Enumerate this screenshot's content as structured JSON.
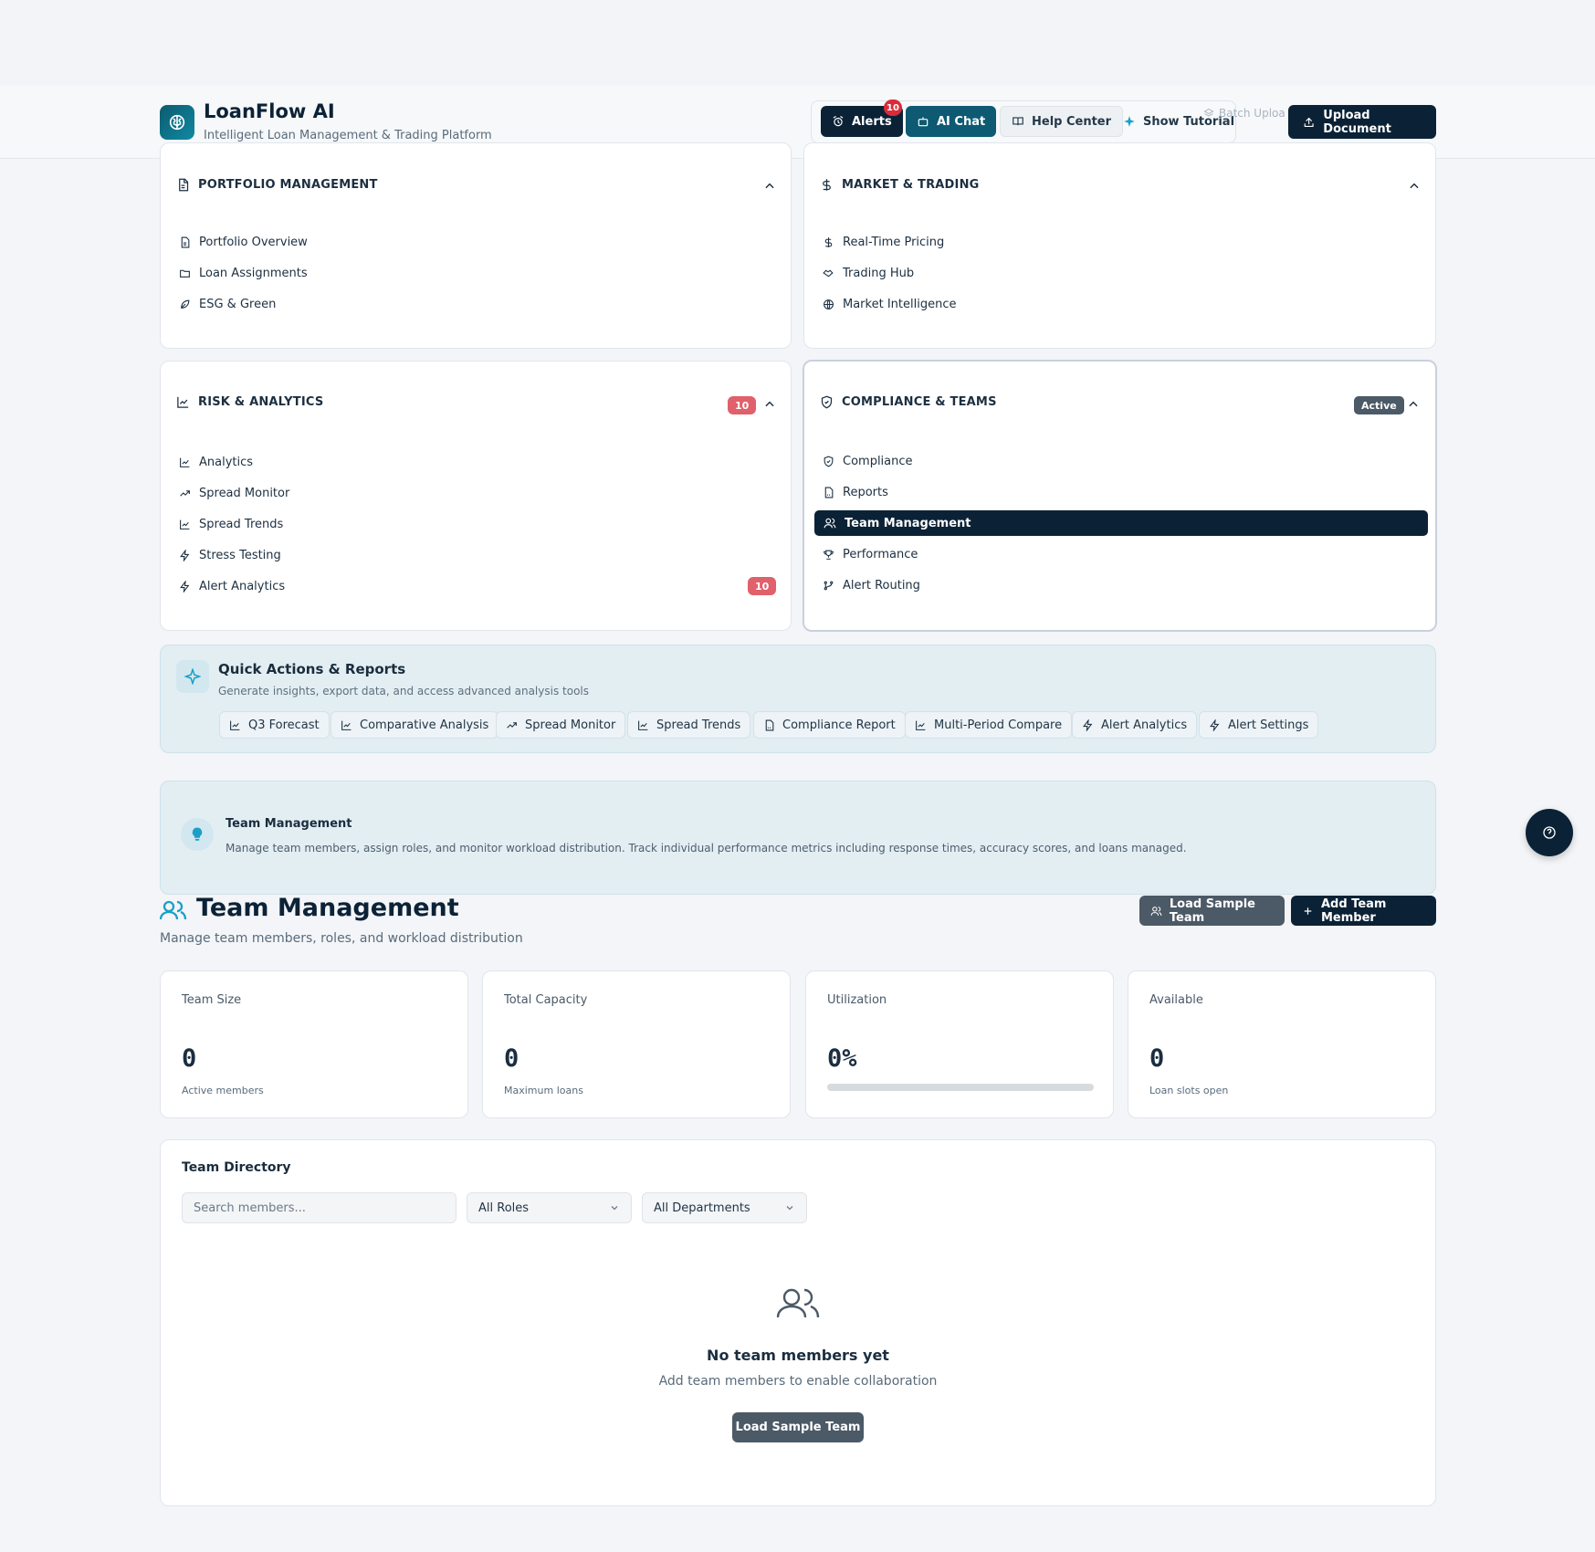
{
  "header": {
    "app_title": "LoanFlow AI",
    "app_subtitle": "Intelligent Loan Management & Trading Platform",
    "alerts_label": "Alerts",
    "alerts_count": "10",
    "ai_chat_label": "AI Chat",
    "help_center_label": "Help Center",
    "show_tutorial_label": "Show Tutorial",
    "batch_upload_label": "Batch Uploa",
    "upload_document_label": "Upload Document"
  },
  "nav": {
    "portfolio": {
      "title": "PORTFOLIO MANAGEMENT",
      "items": [
        {
          "label": "Portfolio Overview",
          "icon": "document-icon"
        },
        {
          "label": "Loan Assignments",
          "icon": "folder-icon"
        },
        {
          "label": "ESG & Green",
          "icon": "leaf-icon"
        }
      ]
    },
    "market": {
      "title": "MARKET & TRADING",
      "items": [
        {
          "label": "Real-Time Pricing",
          "icon": "dollar-icon"
        },
        {
          "label": "Trading Hub",
          "icon": "handshake-icon"
        },
        {
          "label": "Market Intelligence",
          "icon": "globe-icon"
        }
      ]
    },
    "risk": {
      "title": "RISK & ANALYTICS",
      "badge": "10",
      "items": [
        {
          "label": "Analytics",
          "icon": "line-chart-icon"
        },
        {
          "label": "Spread Monitor",
          "icon": "trending-up-icon"
        },
        {
          "label": "Spread Trends",
          "icon": "line-chart-icon"
        },
        {
          "label": "Stress Testing",
          "icon": "bolt-icon"
        },
        {
          "label": "Alert Analytics",
          "icon": "bolt-icon",
          "badge": "10"
        }
      ]
    },
    "compliance": {
      "title": "COMPLIANCE & TEAMS",
      "badge": "Active",
      "items": [
        {
          "label": "Compliance",
          "icon": "shield-icon"
        },
        {
          "label": "Reports",
          "icon": "report-icon"
        },
        {
          "label": "Team Management",
          "icon": "users-icon",
          "selected": true
        },
        {
          "label": "Performance",
          "icon": "trophy-icon"
        },
        {
          "label": "Alert Routing",
          "icon": "git-branch-icon"
        }
      ]
    }
  },
  "quick_actions": {
    "title": "Quick Actions & Reports",
    "subtitle": "Generate insights, export data, and access advanced analysis tools",
    "chips": [
      {
        "label": "Q3 Forecast",
        "icon": "line-chart-icon"
      },
      {
        "label": "Comparative Analysis",
        "icon": "line-chart-icon"
      },
      {
        "label": "Spread Monitor",
        "icon": "trending-up-icon"
      },
      {
        "label": "Spread Trends",
        "icon": "line-chart-icon"
      },
      {
        "label": "Compliance Report",
        "icon": "report-icon"
      },
      {
        "label": "Multi-Period Compare",
        "icon": "line-chart-icon"
      },
      {
        "label": "Alert Analytics",
        "icon": "bolt-icon"
      },
      {
        "label": "Alert Settings",
        "icon": "bolt-icon"
      }
    ]
  },
  "info_banner": {
    "title": "Team Management",
    "description": "Manage team members, assign roles, and monitor workload distribution. Track individual performance metrics including response times, accuracy scores, and loans managed."
  },
  "team": {
    "title": "Team Management",
    "subtitle": "Manage team members, roles, and workload distribution",
    "load_sample_label": "Load Sample Team",
    "add_member_label": "Add Team Member",
    "stats": {
      "team_size": {
        "label": "Team Size",
        "value": "0",
        "sub": "Active members"
      },
      "total_capacity": {
        "label": "Total Capacity",
        "value": "0",
        "sub": "Maximum loans"
      },
      "utilization": {
        "label": "Utilization",
        "value": "0%",
        "progress": 0
      },
      "available": {
        "label": "Available",
        "value": "0",
        "sub": "Loan slots open"
      }
    },
    "directory": {
      "title": "Team Directory",
      "search_placeholder": "Search members...",
      "role_filter": "All Roles",
      "dept_filter": "All Departments",
      "empty_title": "No team members yet",
      "empty_subtitle": "Add team members to enable collaboration",
      "empty_button": "Load Sample Team"
    }
  },
  "colors": {
    "navy": "#0b2236",
    "teal": "#0e5a73",
    "badge_red": "#e0606b",
    "panel_tint": "#e3eef3"
  }
}
